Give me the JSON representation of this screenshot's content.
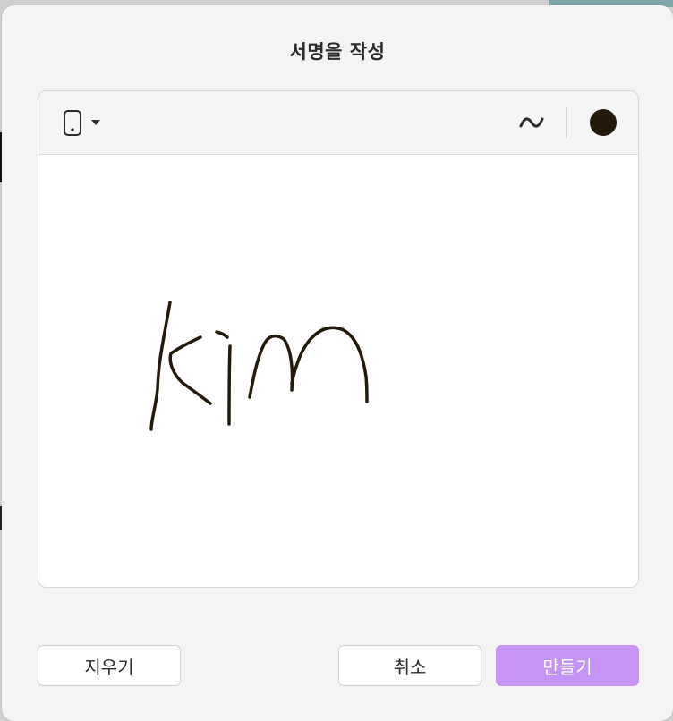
{
  "dialog": {
    "title": "서명을 작성"
  },
  "toolbar": {
    "input_device_icon": "tablet-icon",
    "dropdown_icon": "caret-down-icon",
    "stroke_icon": "tilde-stroke-icon",
    "pen_color": "#231a0b"
  },
  "signature": {
    "written_text": "kim",
    "ink_color": "#231a0b"
  },
  "buttons": {
    "clear_label": "지우기",
    "cancel_label": "취소",
    "create_label": "만들기"
  },
  "colors": {
    "accent": "#c694f6",
    "dialog_background": "#f4f4f4",
    "canvas_background": "#ffffff"
  }
}
